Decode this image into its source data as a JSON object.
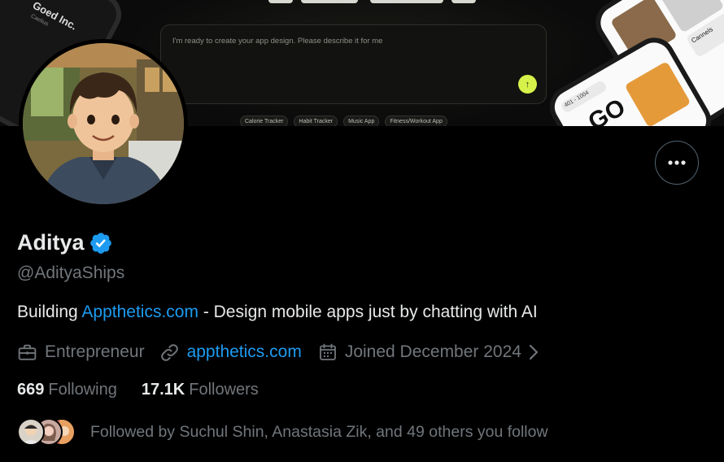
{
  "banner": {
    "prompt_text": "I'm ready to create your app design. Please describe it for me",
    "chips": [
      "Calorie Tracker",
      "Habit Tracker",
      "Music App",
      "Fitness/Workout App"
    ],
    "send_icon": "arrow-up-icon",
    "left_phone_text": "Goed Inc.",
    "left_phone_subtext": "Caelius",
    "right_phone_label": "Cannels",
    "right_phone_big_text": "GO",
    "right_phone_pill": "401 - 1004"
  },
  "profile": {
    "name": "Aditya",
    "handle": "@AdityaShips",
    "bio_prefix": "Building ",
    "bio_link": "Appthetics.com",
    "bio_suffix": " - Design mobile apps just by chatting with AI",
    "profession": "Entrepreneur",
    "website": "appthetics.com",
    "joined": "Joined December 2024",
    "following_count": "669",
    "following_label": "Following",
    "followers_count": "17.1K",
    "followers_label": "Followers",
    "followed_by": "Followed by Suchul Shin, Anastasia Zik, and 49 others you follow"
  },
  "icons": {
    "more": "more-horizontal-icon",
    "verified": "verified-badge-icon",
    "profession": "briefcase-icon",
    "website": "link-icon",
    "joined": "calendar-icon",
    "chevron": "chevron-right-icon"
  },
  "colors": {
    "background": "#000000",
    "text_primary": "#e7e9ea",
    "text_secondary": "#71767b",
    "link": "#1d9bf0",
    "verified": "#1d9bf0",
    "accent_send": "#d6f24a"
  }
}
